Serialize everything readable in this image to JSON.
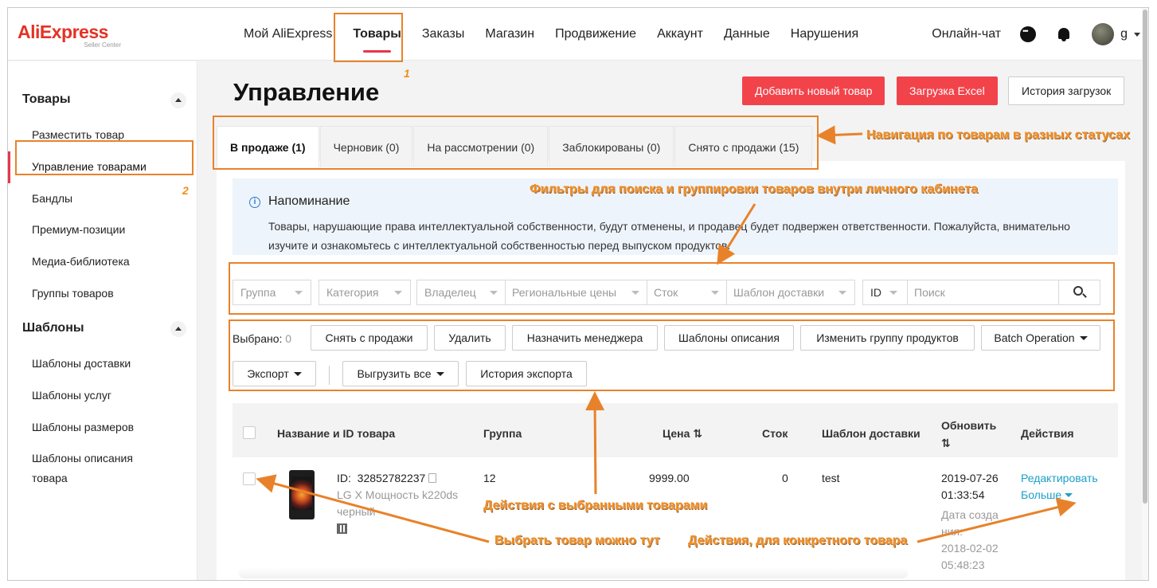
{
  "logo": {
    "brand": "AliExpress",
    "sub": "Seller Center"
  },
  "nav": [
    {
      "label": "Мой AliExpress"
    },
    {
      "label": "Товары"
    },
    {
      "label": "Заказы"
    },
    {
      "label": "Магазин"
    },
    {
      "label": "Продвижение"
    },
    {
      "label": "Аккаунт"
    },
    {
      "label": "Данные"
    },
    {
      "label": "Нарушения"
    }
  ],
  "header_right": {
    "chat": "Онлайн-чат",
    "user": "g",
    "chat_icon": "message-icon",
    "bell_icon": "bell-icon"
  },
  "sidebar": {
    "section1": "Товары",
    "items1": [
      "Разместить товар",
      "Управление товарами",
      "Бандлы",
      "Премиум-позиции",
      "Медиа-библиотека",
      "Группы товаров"
    ],
    "section2": "Шаблоны",
    "items2": [
      "Шаблоны доставки",
      "Шаблоны услуг",
      "Шаблоны размеров",
      "Шаблоны описания",
      "товара"
    ]
  },
  "page": {
    "title": "Управление",
    "btn_add": "Добавить новый товар",
    "btn_excel": "Загрузка Excel",
    "btn_history": "История загрузок"
  },
  "tabs": [
    "В продаже (1)",
    "Черновик (0)",
    "На рассмотрении (0)",
    "Заблокированы (0)",
    "Снято с продажи (15)"
  ],
  "notice": {
    "title": "Напоминание",
    "text": "Товары, нарушающие права интеллектуальной собственности, будут отменены, и продавец будет подвержен ответственности. Пожалуйста, внимательно изучите и ознакомьтесь с интеллектуальной собственностью перед выпуском продуктов."
  },
  "filters": {
    "group": "Группа",
    "category": "Категория",
    "owner": "Владелец",
    "regional": "Региональные цены",
    "stock": "Сток",
    "shipping": "Шаблон доставки",
    "id": "ID",
    "search_placeholder": "Поиск"
  },
  "actions": {
    "selected_label": "Выбрано:",
    "selected_count": "0",
    "buttons": [
      "Снять с продажи",
      "Удалить",
      "Назначить менеджера",
      "Шаблоны описания",
      "Изменить группу продуктов",
      "Batch Operation"
    ],
    "export": "Экспорт",
    "export_all": "Выгрузить все",
    "export_history": "История экспорта"
  },
  "table": {
    "headers": {
      "name": "Название и ID товара",
      "group": "Группа",
      "price": "Цена",
      "stock": "Сток",
      "shipping": "Шаблон доставки",
      "updated": "Обновить",
      "actions": "Действия"
    },
    "rows": [
      {
        "id_label": "ID:",
        "id": "32852782237",
        "name_line1": "LG X Мощность k220ds",
        "name_line2": "черный",
        "group": "12",
        "price": "9999.00",
        "stock": "0",
        "shipping": "test",
        "updated_date": "2019-07-26",
        "updated_time": "01:33:54",
        "created_label_1": "Дата созда",
        "created_label_2": "ния:",
        "created_date": "2018-02-02",
        "created_time": "05:48:23",
        "edit": "Редактировать",
        "more": "Больше"
      }
    ]
  },
  "annotations": {
    "num1": "1",
    "num2": "2",
    "tabs_note": "Навигация по товарам в разных статусах",
    "filters_note": "Фильтры для поиска и группировки товаров внутри личного кабинета",
    "actions_note": "Действия с выбранными товарами",
    "select_note": "Выбрать товар можно тут",
    "row_actions_note": "Действия, для конкретного товара",
    "accent_color": "#e8822a"
  }
}
